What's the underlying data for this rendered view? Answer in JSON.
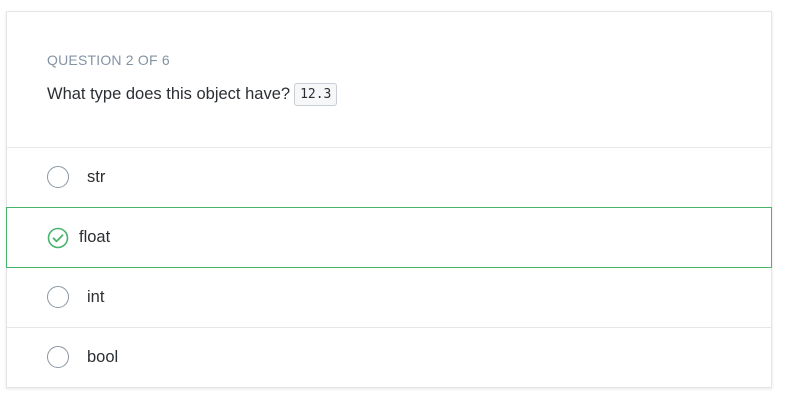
{
  "quiz": {
    "counter": "QUESTION 2 OF 6",
    "question_text": "What type does this object have?",
    "code_snippet": "12.3",
    "options": [
      {
        "label": "str",
        "selected": false
      },
      {
        "label": "float",
        "selected": true
      },
      {
        "label": "int",
        "selected": false
      },
      {
        "label": "bool",
        "selected": false
      }
    ]
  },
  "colors": {
    "correct_accent": "#48b36b",
    "counter_text": "#8493a4",
    "radio_border": "#8c96a1"
  }
}
